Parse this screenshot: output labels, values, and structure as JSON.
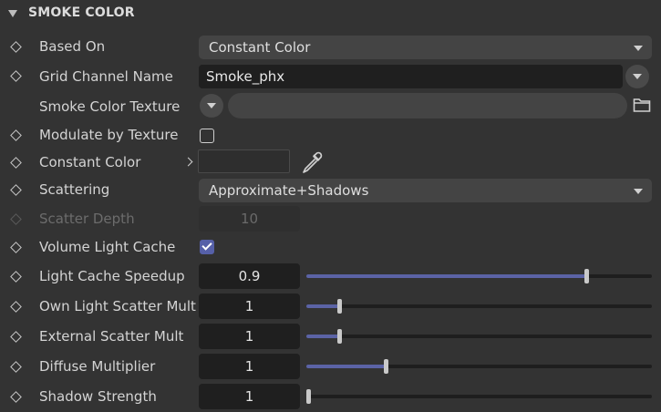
{
  "section": {
    "title": "SMOKE COLOR"
  },
  "rows": {
    "based_on": {
      "label": "Based On",
      "value": "Constant Color"
    },
    "grid_channel": {
      "label": "Grid Channel Name",
      "value": "Smoke_phx"
    },
    "color_texture": {
      "label": "Smoke Color Texture",
      "value": ""
    },
    "modulate": {
      "label": "Modulate by Texture",
      "checked": false
    },
    "constant_color": {
      "label": "Constant Color",
      "color": "#2e2e2e"
    },
    "scattering": {
      "label": "Scattering",
      "value": "Approximate+Shadows"
    },
    "scatter_depth": {
      "label": "Scatter Depth",
      "value": "10",
      "enabled": false
    },
    "volume_light_cache": {
      "label": "Volume Light Cache",
      "checked": true
    },
    "light_cache_speedup": {
      "label": "Light Cache Speedup",
      "value": "0.9",
      "fraction": 0.9
    },
    "own_light_scatter": {
      "label": "Own Light Scatter Mult",
      "value": "1",
      "fraction": 0.1
    },
    "external_scatter": {
      "label": "External Scatter Mult",
      "value": "1",
      "fraction": 0.1
    },
    "diffuse_multiplier": {
      "label": "Diffuse Multiplier",
      "value": "1",
      "fraction": 0.25
    },
    "shadow_strength": {
      "label": "Shadow Strength",
      "value": "1",
      "fraction": 0.0
    }
  },
  "colors": {
    "accent": "#5b63a5",
    "checkbox_on": "#5660a8",
    "panel": "#333333",
    "field": "#1f1f1f"
  },
  "icons": {
    "collapse": "triangle-down",
    "keyframe": "diamond",
    "folder": "folder-icon",
    "picker": "eyedropper-icon"
  }
}
